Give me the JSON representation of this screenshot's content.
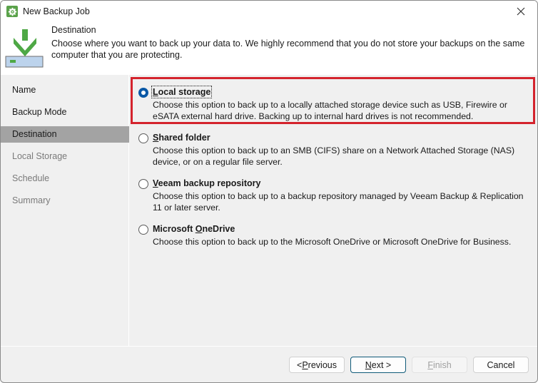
{
  "window": {
    "title": "New Backup Job",
    "close_icon": "close-icon",
    "app_icon": "gear-icon"
  },
  "header": {
    "title": "Destination",
    "description": "Choose where you want to back up your data to. We highly recommend that you do not store your backups on the same computer that you are protecting.",
    "icon": "download-to-drive-icon"
  },
  "sidebar": {
    "items": [
      {
        "label": "Name",
        "state": "done"
      },
      {
        "label": "Backup Mode",
        "state": "done"
      },
      {
        "label": "Destination",
        "state": "active"
      },
      {
        "label": "Local Storage",
        "state": "pending"
      },
      {
        "label": "Schedule",
        "state": "pending"
      },
      {
        "label": "Summary",
        "state": "pending"
      }
    ]
  },
  "options": [
    {
      "label_pre": "",
      "label_mnemonic": "L",
      "label_post": "ocal storage",
      "description": "Choose this option to back up to a locally attached storage device such as USB, Firewire or eSATA external hard drive. Backing up to internal hard drives is not recommended.",
      "selected": true,
      "highlighted": true
    },
    {
      "label_pre": "",
      "label_mnemonic": "S",
      "label_post": "hared folder",
      "description": "Choose this option to back up to an SMB (CIFS) share on a Network Attached Storage (NAS) device, or on a regular file server.",
      "selected": false
    },
    {
      "label_pre": "",
      "label_mnemonic": "V",
      "label_post": "eeam backup repository",
      "description": "Choose this option to back up to a backup repository managed by Veeam Backup & Replication 11 or later server.",
      "selected": false
    },
    {
      "label_pre": "Microsoft ",
      "label_mnemonic": "O",
      "label_post": "neDrive",
      "description": "Choose this option to back up to the Microsoft OneDrive or Microsoft OneDrive for Business.",
      "selected": false
    }
  ],
  "buttons": {
    "previous": {
      "pre": "< ",
      "mnemonic": "P",
      "post": "revious"
    },
    "next": {
      "pre": "",
      "mnemonic": "N",
      "post": "ext >"
    },
    "finish": {
      "pre": "",
      "mnemonic": "F",
      "post": "inish",
      "disabled": true
    },
    "cancel": {
      "label": "Cancel"
    }
  },
  "colors": {
    "selection_radio": "#0a58a6",
    "highlight_border": "#d4232d",
    "active_nav": "#a3a3a3",
    "brand_green": "#5aa24a"
  }
}
